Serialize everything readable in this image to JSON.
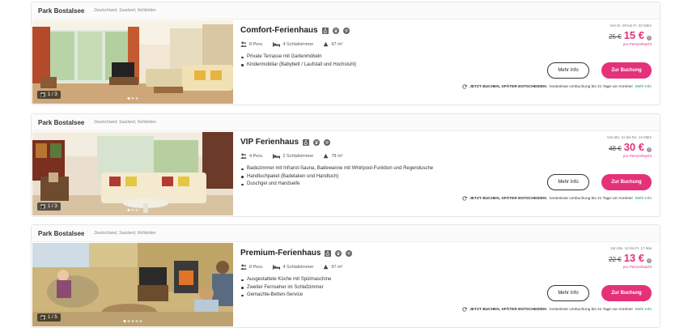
{
  "cards": [
    {
      "park": "Park Bostalsee",
      "region": "Deutschland, Saarland, Nohfelden",
      "photo_counter": "1 / 3",
      "title": "Comfort-Ferienhaus",
      "persons": "8 Pers.",
      "bedrooms": "4 Schlafzimmer",
      "area": "97 m²",
      "features": [
        "Private Terrasse mit Gartenmöbeln",
        "Kindermobiliar (Babybett / Laufstall und Hochstuhl)"
      ],
      "date_range": "Von Di. 29 bis Fr. 22 März",
      "old_price": "25 €",
      "new_price": "15 €",
      "per_person": "pro Person/Nacht",
      "more_info": "Mehr Info",
      "book": "Zur Buchung",
      "book_later_bold": "JETZT BUCHEN, SPÄTER ENTSCHEIDEN:",
      "book_later_text": "kostenlose Umbuchung bis 21 Tage vor Anreise!",
      "book_later_link": "Mehr Info"
    },
    {
      "park": "Park Bostalsee",
      "region": "Deutschland, Saarland, Nohfelden",
      "photo_counter": "1 / 3",
      "title": "VIP Ferienhaus",
      "persons": "4 Pers.",
      "bedrooms": "2 Schlafzimmer",
      "area": "78 m²",
      "features": [
        "Badezimmer mit Infrarot-Sauna, Badewanne mit Whirlpool-Funktion und Regendusche",
        "Handtuchpaket (Badelaken und Handtuch)",
        "Duschgel und Handseife"
      ],
      "date_range": "Von Mo. 11 bis Do. 14 März",
      "old_price": "48 €",
      "new_price": "30 €",
      "per_person": "pro Person/Nacht",
      "more_info": "Mehr Info",
      "book": "Zur Buchung",
      "book_later_bold": "JETZT BUCHEN, SPÄTER ENTSCHEIDEN:",
      "book_later_text": "kostenlose Umbuchung bis 21 Tage vor Anreise!",
      "book_later_link": "Mehr Info"
    },
    {
      "park": "Park Bostalsee",
      "region": "Deutschland, Saarland, Nohfelden",
      "photo_counter": "1 / 5",
      "title": "Premium-Ferienhaus",
      "persons": "8 Pers.",
      "bedrooms": "4 Schlafzimmer",
      "area": "97 m²",
      "features": [
        "Ausgestattete Küche mit Spülmaschine",
        "Zweiter Fernseher im Schlafzimmer",
        "Gemachte-Betten-Service"
      ],
      "date_range": "Von Mo. 12 bis Fr. 17 Mai",
      "old_price": "22 €",
      "new_price": "13 €",
      "per_person": "pro Person/Nacht",
      "more_info": "Mehr Info",
      "book": "Zur Buchung",
      "book_later_bold": "JETZT BUCHEN, SPÄTER ENTSCHEIDEN:",
      "book_later_text": "kostenlose Umbuchung bis 21 Tage vor Anreise!",
      "book_later_link": "Mehr Info"
    }
  ],
  "colors": {
    "accent": "#e4317a",
    "link": "#1a8f6a"
  },
  "icons": [
    "wheelchair-icon",
    "pet-paw-icon",
    "wifi-icon",
    "persons-icon",
    "bed-icon",
    "area-icon",
    "gallery-icon",
    "rebook-icon",
    "info-icon"
  ]
}
